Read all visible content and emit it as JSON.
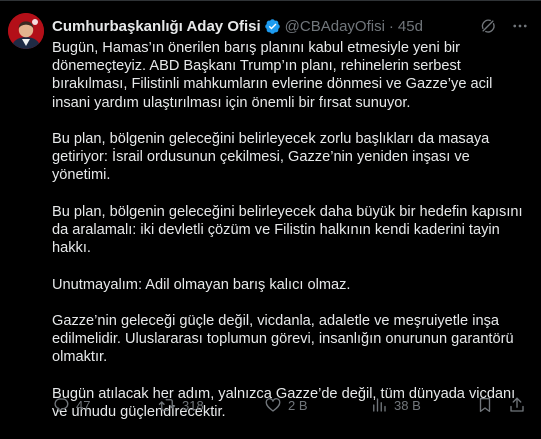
{
  "tweet": {
    "display_name": "Cumhurbaşkanlığı Aday Ofisi",
    "handle": "@CBAdayOfisi",
    "separator": "·",
    "time": "45d",
    "verified_color": "#1d9bf0",
    "paragraphs": [
      "Bugün, Hamas’ın önerilen barış planını kabul etmesiyle yeni bir dönemeçteyiz. ABD Başkanı Trump’ın planı, rehinelerin serbest bırakılması, Filistinli mahkumların evlerine dönmesi ve Gazze’ye acil insani yardım ulaştırılması için önemli bir fırsat sunuyor.",
      "Bu plan, bölgenin geleceğini belirleyecek zorlu başlıkları da masaya getiriyor: İsrail ordusunun çekilmesi, Gazze’nin yeniden inşası ve yönetimi.",
      "Bu plan, bölgenin geleceğini belirleyecek daha büyük bir hedefin kapısını da aralamalı: iki devletli çözüm ve Filistin halkının kendi kaderini tayin hakkı.",
      "Unutmayalım: Adil olmayan barış kalıcı olmaz.",
      "Gazze’nin geleceği güçle değil, vicdanla, adaletle ve meşruiyetle inşa edilmelidir. Uluslararası toplumun görevi, insanlığın onurunun garantörü olmaktır.",
      "Bugün atılacak her adım, yalnızca Gazze’de değil, tüm dünyada vicdanı ve umudu güçlendirecektir."
    ],
    "metrics": {
      "replies": "47",
      "reposts": "318",
      "likes": "2 B",
      "views": "38 B"
    },
    "icons": {
      "header": [
        "grok-icon",
        "more-icon"
      ],
      "actions": [
        "reply-icon",
        "repost-icon",
        "like-icon",
        "views-icon",
        "bookmark-icon",
        "share-icon"
      ]
    }
  }
}
